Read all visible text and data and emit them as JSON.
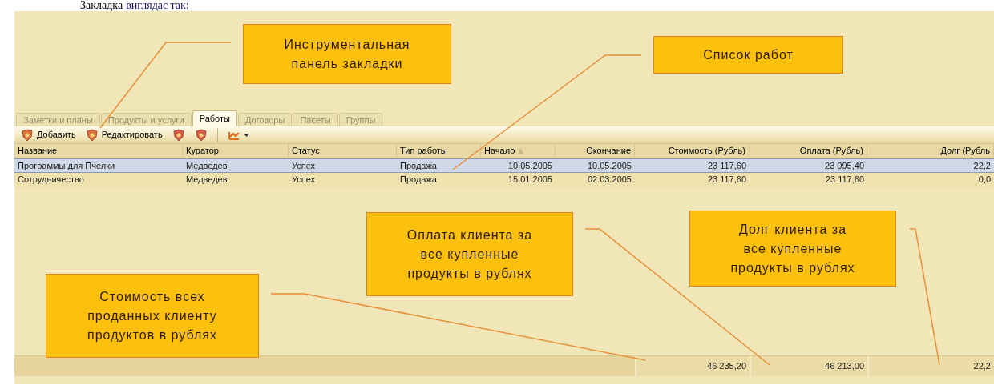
{
  "caption": {
    "parts": [
      "Закладка",
      "виглядає так:"
    ]
  },
  "tabs": [
    {
      "label": "Заметки и планы",
      "selected": false
    },
    {
      "label": "Продукты и услуги",
      "selected": false
    },
    {
      "label": "Работы",
      "selected": true
    },
    {
      "label": "Договоры",
      "selected": false
    },
    {
      "label": "Пасеты",
      "selected": false
    },
    {
      "label": "Группы",
      "selected": false
    }
  ],
  "toolbar": [
    {
      "kind": "button",
      "label": "Добавить"
    },
    {
      "kind": "button",
      "label": "Редактировать"
    },
    {
      "kind": "icon"
    },
    {
      "kind": "icon"
    },
    {
      "kind": "separator"
    },
    {
      "kind": "dropdown"
    }
  ],
  "table": {
    "columns": [
      {
        "label": "Название",
        "sorted": false
      },
      {
        "label": "Куратор",
        "sorted": false
      },
      {
        "label": "Статус",
        "sorted": false
      },
      {
        "label": "Тип работы",
        "sorted": false
      },
      {
        "label": "Начало",
        "sorted": true
      },
      {
        "label": "Окончание",
        "sorted": false
      },
      {
        "label": "Стоимость (Рубль)",
        "sorted": false
      },
      {
        "label": "Оплата  (Рубль)",
        "sorted": false
      },
      {
        "label": "Долг (Рубль",
        "sorted": false
      }
    ],
    "rows": [
      {
        "selected": true,
        "cells": [
          "Программы для Пчелки",
          "Медведев",
          "Успех",
          "Продажа",
          "10.05.2005",
          "10.05.2005",
          "23 117,60",
          "23 095,40",
          "22,2"
        ]
      },
      {
        "selected": false,
        "cells": [
          "Сотрудничество",
          "Медведев",
          "Успех",
          "Продажа",
          "15.01.2005",
          "02.03.2005",
          "23 117,60",
          "23 117,60",
          "0,0"
        ]
      }
    ],
    "totals": [
      "46 235,20",
      "46 213,00",
      "22,2"
    ]
  },
  "callouts": [
    {
      "lines": [
        "Инструментальная",
        "панель закладки"
      ]
    },
    {
      "lines": [
        "Список работ"
      ]
    },
    {
      "lines": [
        "Оплата клиента за",
        "все купленные",
        "продукты в рублях"
      ]
    },
    {
      "lines": [
        "Долг клиента за",
        "все купленные",
        "продукты в рублях"
      ]
    },
    {
      "lines": [
        "Стоимость всех",
        "проданных клиенту",
        "продуктов в рублях"
      ]
    }
  ]
}
